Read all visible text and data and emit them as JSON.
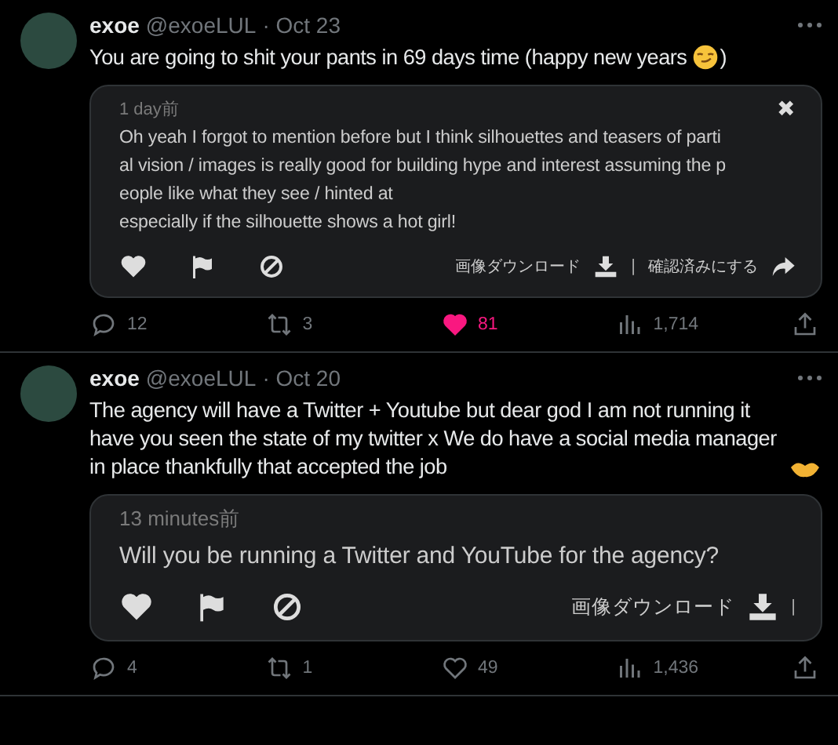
{
  "tweets": [
    {
      "name": "exoe",
      "handle": "@exoeLUL",
      "date": "· Oct 23",
      "text": "You are going to shit your pants in 69 days time (happy new years",
      "text_end": ")",
      "kind": "smirk",
      "card": {
        "kind": "compact",
        "time": "1 day前",
        "message": "Oh yeah I forgot to mention before but I think silhouettes and teasers of parti\nal vision / images is really good for building hype and interest assuming the p\neople like what they see / hinted at\nespecially if the silhouette shows a hot girl!",
        "close": "✖",
        "download": "画像ダウンロード",
        "separator": "|",
        "confirm": "確認済みにする"
      },
      "replies": "12",
      "reposts": "3",
      "likes": "81",
      "liked": true,
      "views": "1,714"
    },
    {
      "name": "exoe",
      "handle": "@exoeLUL",
      "date": "· Oct 20",
      "text": "The agency will have a Twitter + Youtube but dear god I am not running it have you seen the state of my twitter x We do have a social media manager in place thankfully that accepted the job",
      "kind": "handshake",
      "card": {
        "kind": "large",
        "time": "13 minutes前",
        "message": "Will you be running a Twitter and YouTube for the agency?",
        "download": "画像ダウンロード",
        "separator": "|"
      },
      "replies": "4",
      "reposts": "1",
      "likes": "49",
      "liked": false,
      "views": "1,436"
    }
  ]
}
